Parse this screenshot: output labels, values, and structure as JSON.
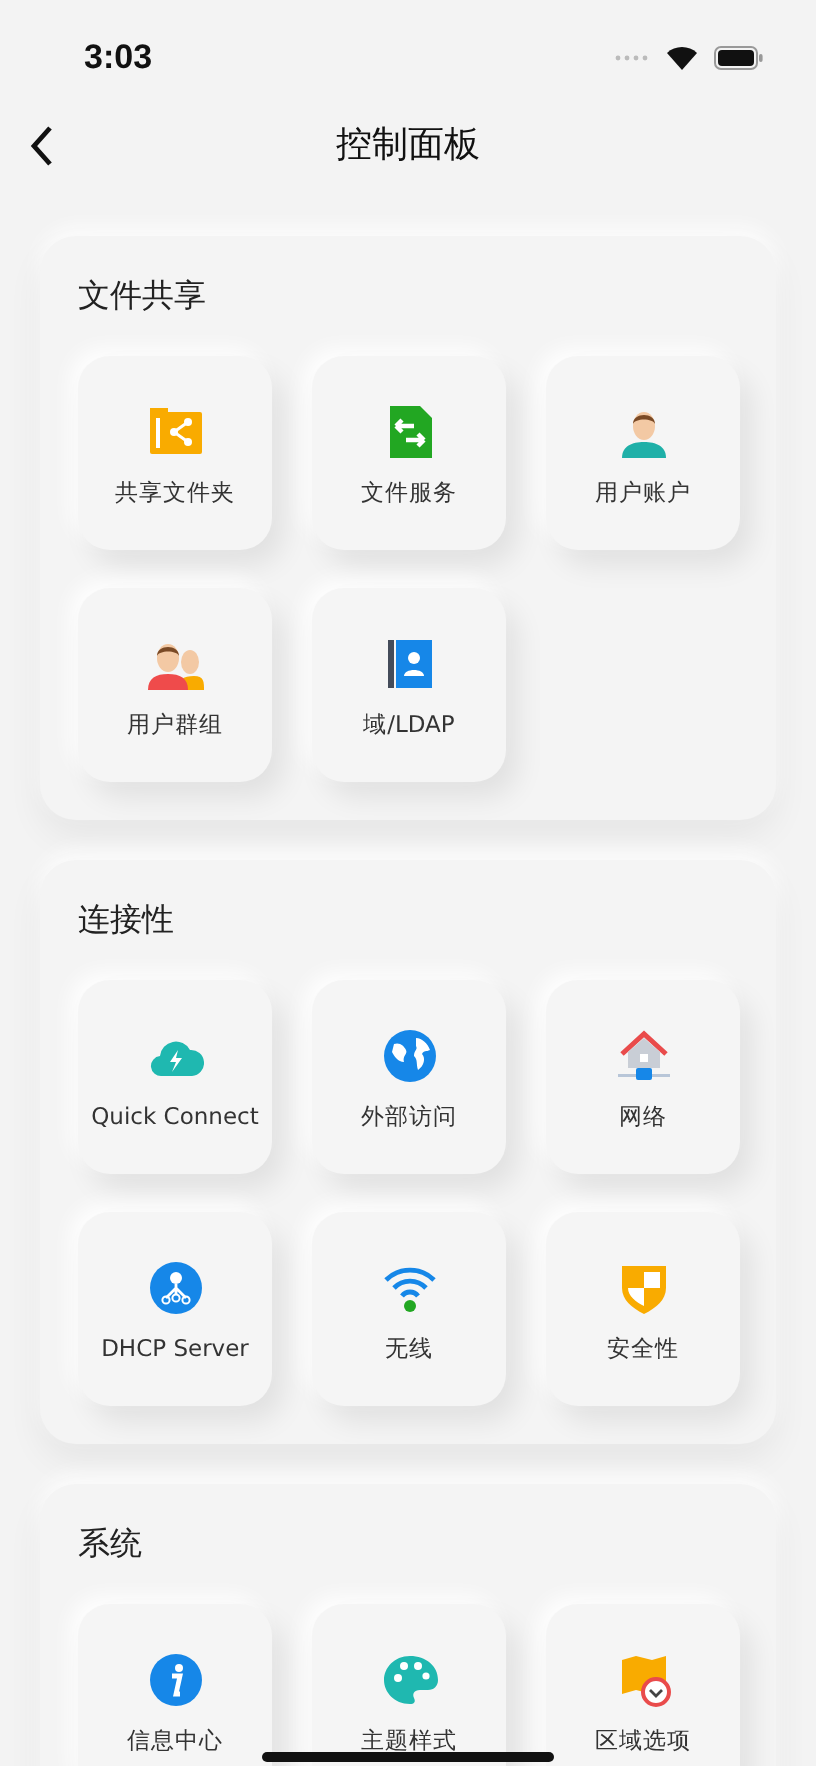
{
  "status_bar": {
    "time": "3:03"
  },
  "nav": {
    "title": "控制面板"
  },
  "sections": [
    {
      "title": "文件共享",
      "items": [
        {
          "label": "共享文件夹"
        },
        {
          "label": "文件服务"
        },
        {
          "label": "用户账户"
        },
        {
          "label": "用户群组"
        },
        {
          "label": "域/LDAP"
        }
      ]
    },
    {
      "title": "连接性",
      "items": [
        {
          "label": "Quick Connect"
        },
        {
          "label": "外部访问"
        },
        {
          "label": "网络"
        },
        {
          "label": "DHCP Server"
        },
        {
          "label": "无线"
        },
        {
          "label": "安全性"
        }
      ]
    },
    {
      "title": "系统",
      "items": [
        {
          "label": "信息中心"
        },
        {
          "label": "主题样式"
        },
        {
          "label": "区域选项"
        }
      ]
    }
  ]
}
